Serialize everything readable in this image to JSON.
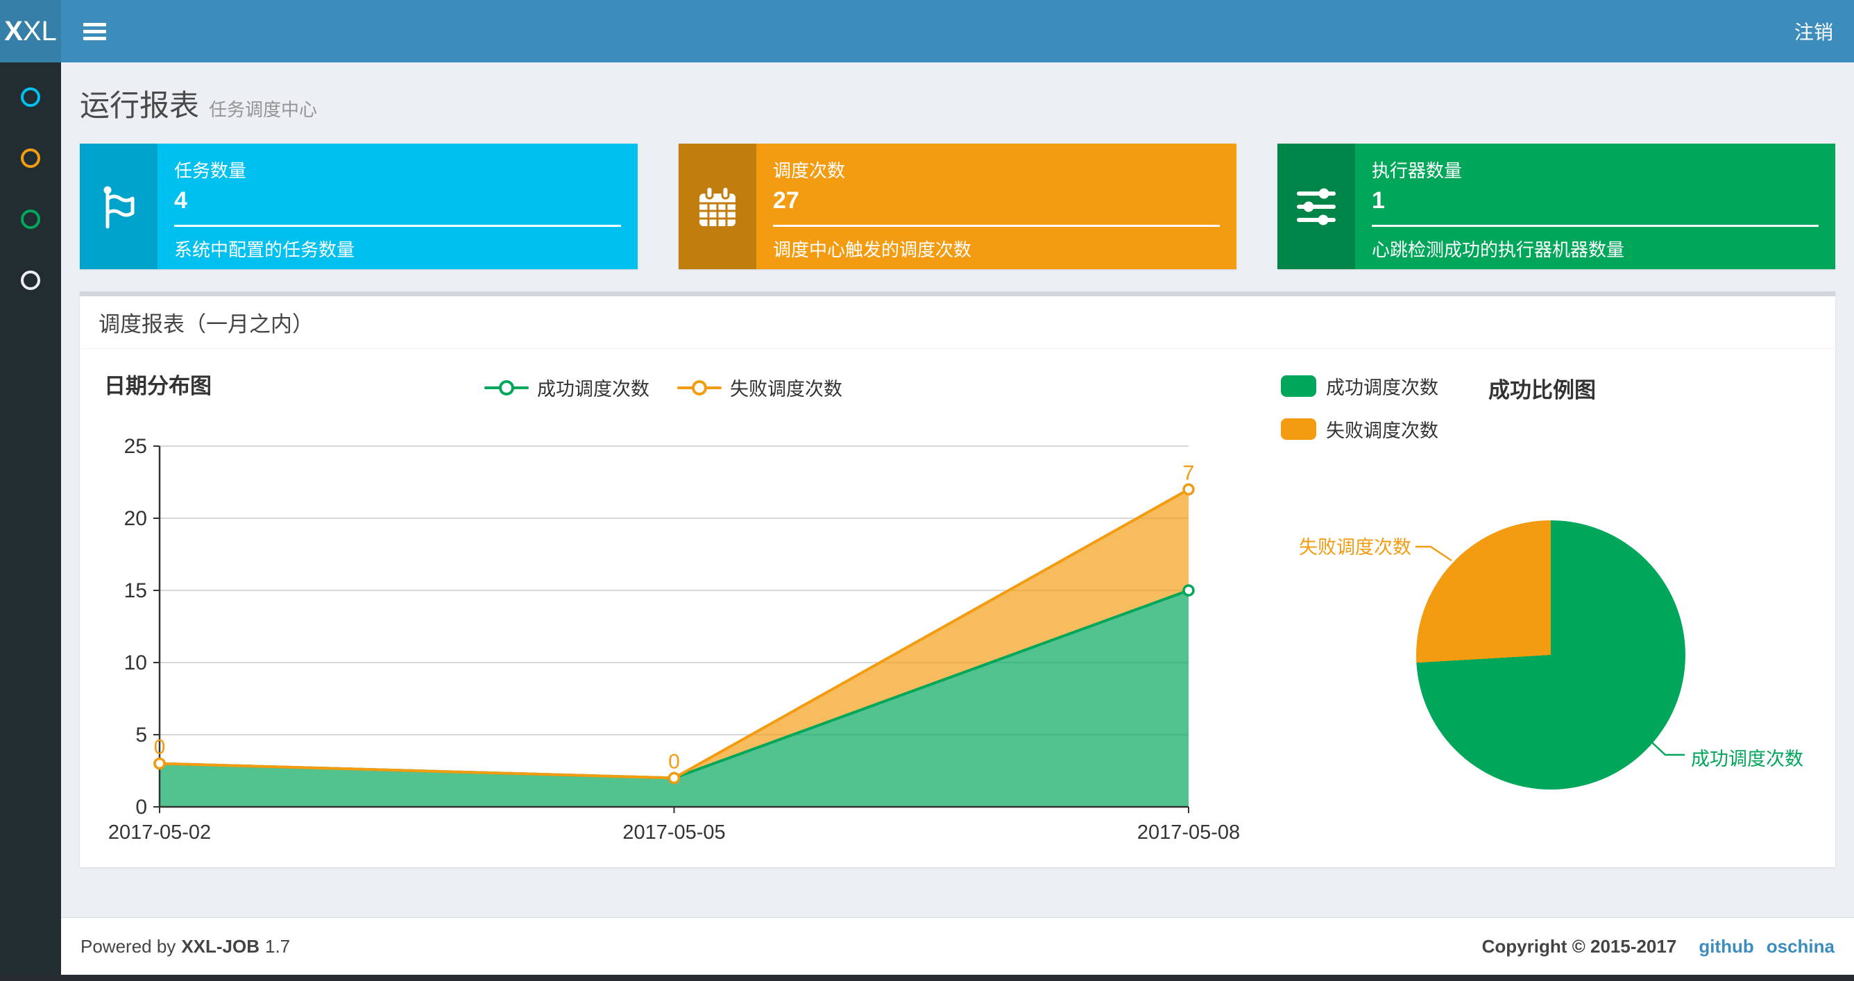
{
  "navbar": {
    "logo_bold": "X",
    "logo_rest": "XL",
    "logout": "注销"
  },
  "sidebar": {
    "items": [
      {
        "name": "menu-item-1",
        "color": "#00c0ef"
      },
      {
        "name": "menu-item-2",
        "color": "#f39c12"
      },
      {
        "name": "menu-item-3",
        "color": "#00a65a"
      },
      {
        "name": "menu-item-4",
        "color": "#eceff1"
      }
    ]
  },
  "header": {
    "title": "运行报表",
    "subtitle": "任务调度中心"
  },
  "info_boxes": [
    {
      "label": "任务数量",
      "value": "4",
      "desc": "系统中配置的任务数量",
      "bg": "#00c0ef",
      "icon_bg": "#00a3cb",
      "icon": "flag"
    },
    {
      "label": "调度次数",
      "value": "27",
      "desc": "调度中心触发的调度次数",
      "bg": "#f39c12",
      "icon_bg": "#c17d0e",
      "icon": "calendar"
    },
    {
      "label": "执行器数量",
      "value": "1",
      "desc": "心跳检测成功的执行器机器数量",
      "bg": "#00a65a",
      "icon_bg": "#008548",
      "icon": "sliders"
    }
  ],
  "panel": {
    "title": "调度报表（一月之内）"
  },
  "chart_data": [
    {
      "type": "area",
      "title": "日期分布图",
      "stacked": true,
      "x": [
        "2017-05-02",
        "2017-05-05",
        "2017-05-08"
      ],
      "series": [
        {
          "name": "成功调度次数",
          "color": "#00A65A",
          "values": [
            3,
            2,
            15
          ]
        },
        {
          "name": "失败调度次数",
          "color": "#F39C12",
          "values": [
            0,
            0,
            7
          ],
          "labels": [
            "0",
            "0",
            "7"
          ]
        }
      ],
      "ylim": [
        0,
        25
      ],
      "yticks": [
        0,
        5,
        10,
        15,
        20,
        25
      ],
      "grid": true,
      "legend_position": "top-center"
    },
    {
      "type": "pie",
      "title": "成功比例图",
      "labels": [
        "成功调度次数",
        "失败调度次数"
      ],
      "values": [
        20,
        7
      ],
      "colors": [
        "#00A65A",
        "#F39C12"
      ],
      "legend_position": "top-left"
    }
  ],
  "footer": {
    "powered": "Powered by",
    "product": "XXL-JOB",
    "version": "1.7",
    "copyright": "Copyright © 2015-2017",
    "links": [
      {
        "label": "github"
      },
      {
        "label": "oschina"
      }
    ]
  }
}
